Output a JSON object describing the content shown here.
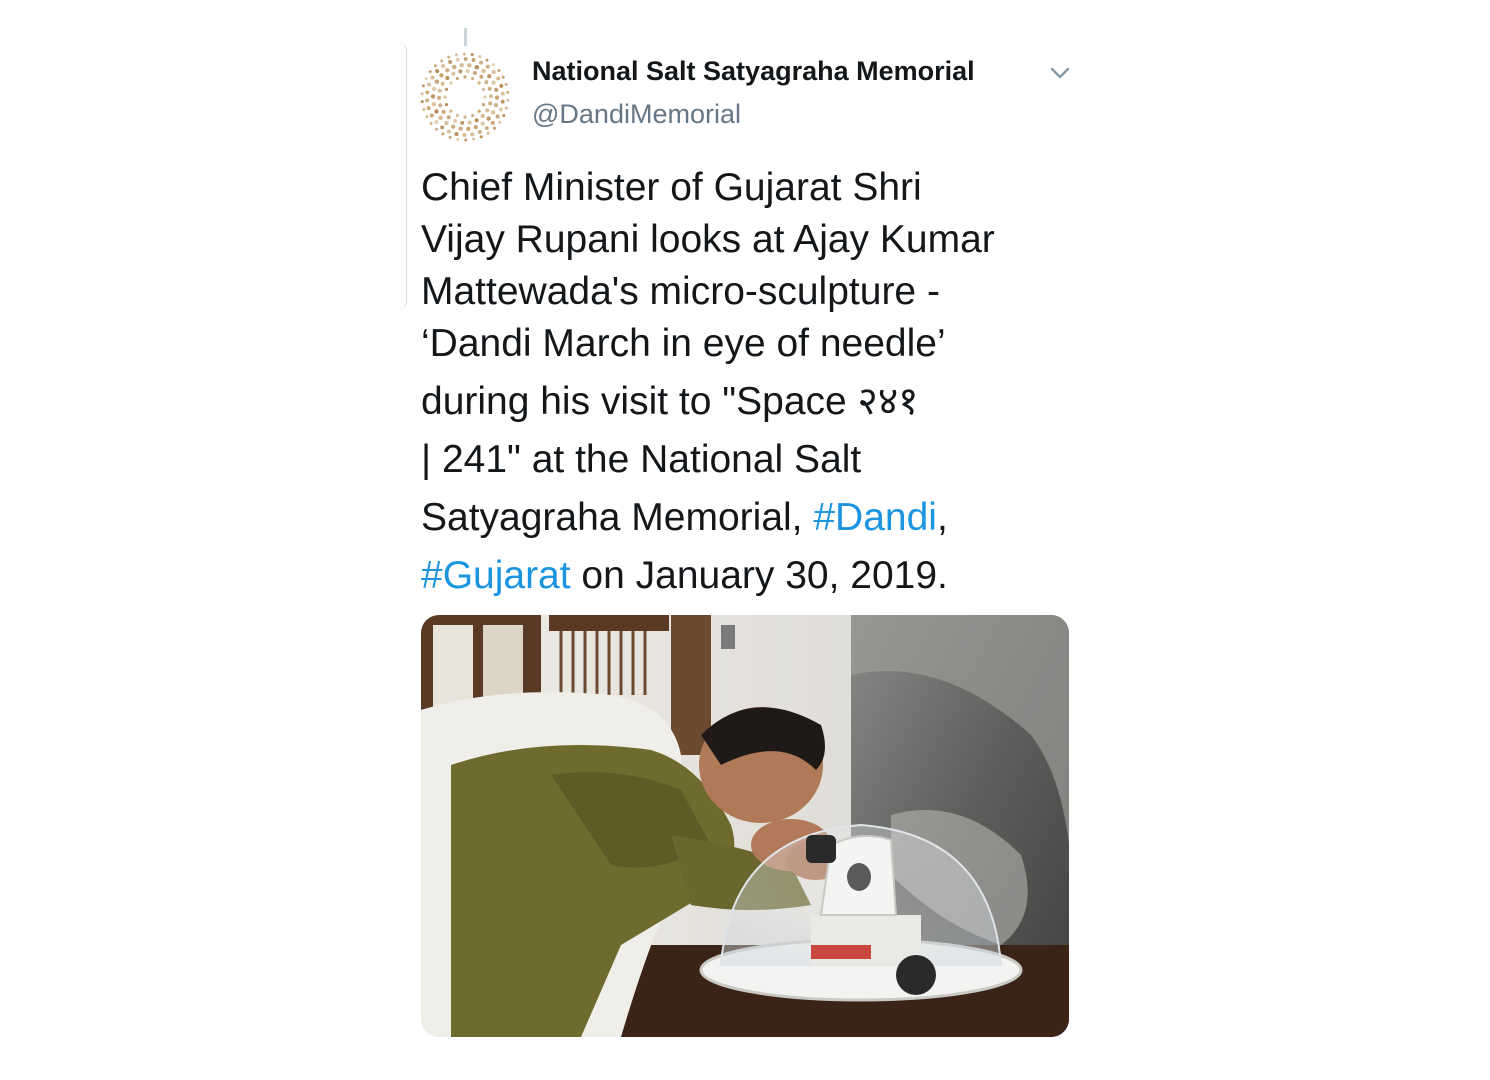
{
  "tweet": {
    "account": {
      "name": "National Salt Satyagraha Memorial",
      "handle": "@DandiMemorial",
      "avatar_icon": "memorial-logo-icon",
      "avatar_colors": [
        "#c9a06a",
        "#b5864e"
      ]
    },
    "menu_icon": "chevron-down-icon",
    "text_lines": [
      [
        {
          "t": "Chief Minister of Gujarat Shri"
        }
      ],
      [
        {
          "t": "Vijay Rupani looks at Ajay Kumar"
        }
      ],
      [
        {
          "t": "Mattewada's micro-sculpture -"
        }
      ],
      [
        {
          "t": "‘Dandi March in eye of needle’"
        }
      ],
      [
        {
          "t": "during his visit to \"Space २४१"
        }
      ],
      [
        {
          "t": "| 241\" at the National Salt"
        }
      ],
      [
        {
          "t": "Satyagraha Memorial, "
        },
        {
          "t": "#Dandi",
          "hashtag": true
        },
        {
          "t": ","
        }
      ],
      [
        {
          "t": "#Gujarat",
          "hashtag": true
        },
        {
          "t": " on January 30, 2019."
        }
      ]
    ],
    "media": {
      "kind": "photo",
      "subject": "man-looking-into-microscope-photo"
    },
    "colors": {
      "text": "#14171a",
      "secondary": "#657786",
      "link": "#1b95e0"
    }
  }
}
